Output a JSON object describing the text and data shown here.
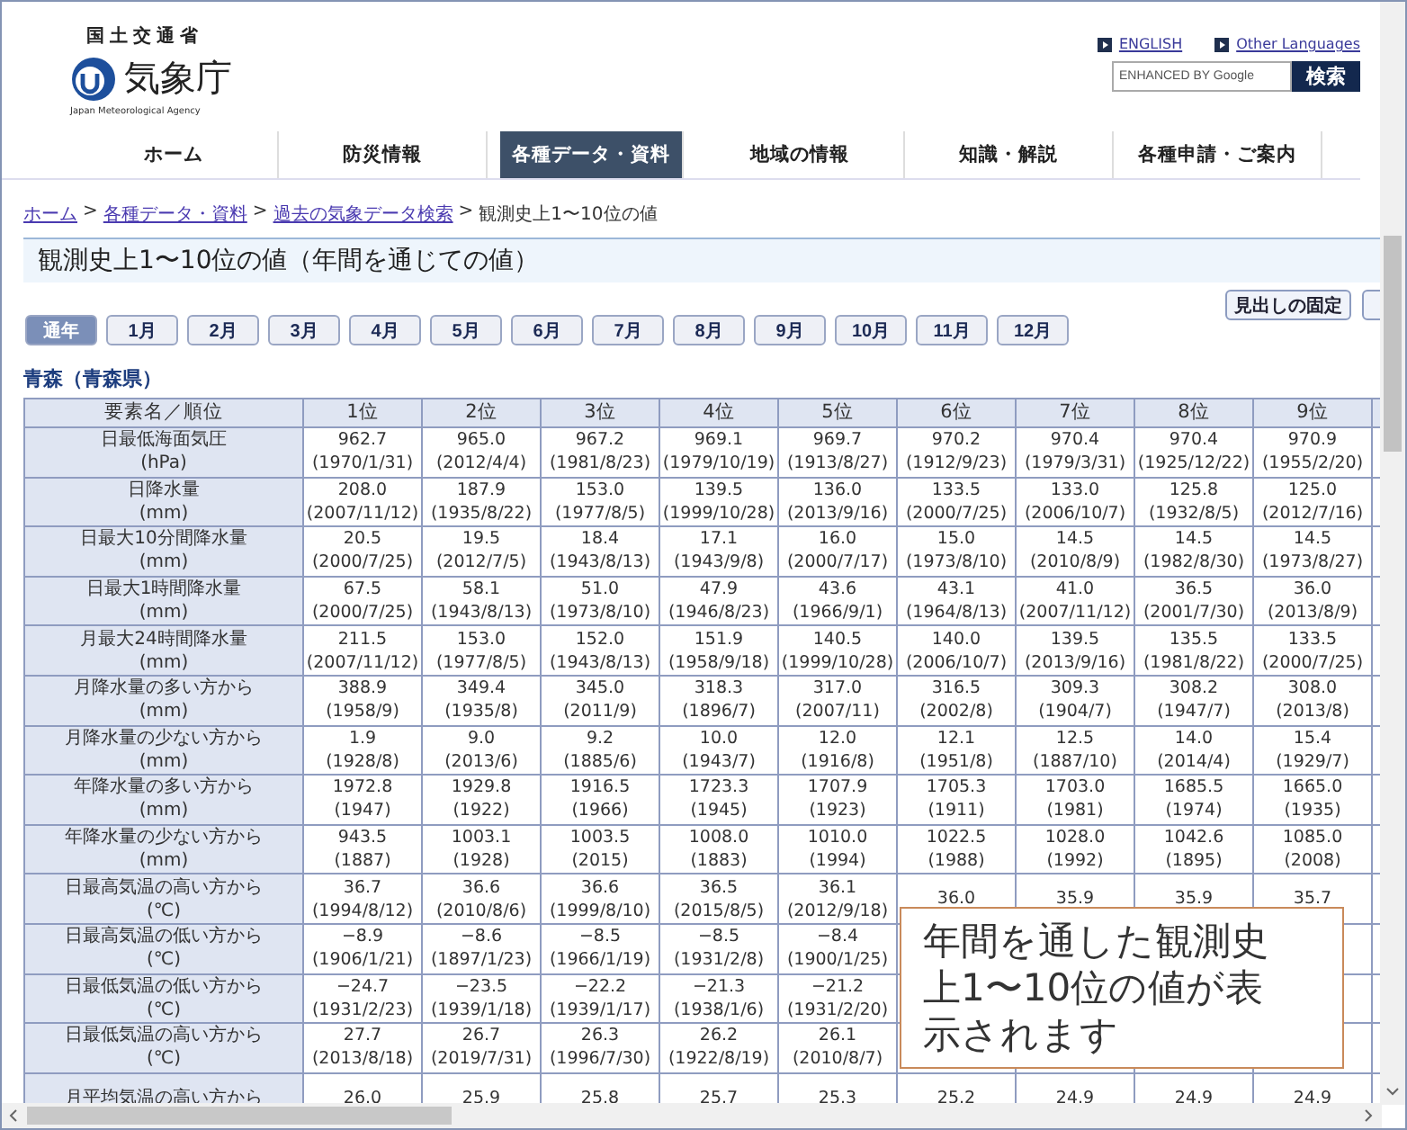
{
  "header": {
    "ministry": "国土交通省",
    "agency": "気象庁",
    "agency_en": "Japan Meteorological Agency",
    "links": [
      "ENGLISH",
      "Other Languages"
    ],
    "search": {
      "placeholder": "ENHANCED BY Google",
      "button": "検索"
    }
  },
  "nav": [
    {
      "label": "ホーム",
      "selected": false
    },
    {
      "label": "防災情報",
      "selected": false
    },
    {
      "label": "各種データ・資料",
      "selected": true
    },
    {
      "label": "地域の情報",
      "selected": false
    },
    {
      "label": "知識・解説",
      "selected": false
    },
    {
      "label": "各種申請・ご案内",
      "selected": false
    }
  ],
  "breadcrumb": {
    "separator": ">",
    "items": [
      {
        "label": "ホーム",
        "link": true
      },
      {
        "label": "各種データ・資料",
        "link": true
      },
      {
        "label": "過去の気象データ検索",
        "link": true
      },
      {
        "label": "観測史上1〜10位の値",
        "link": false
      }
    ]
  },
  "page_title": "観測史上1〜10位の値（年間を通じての値）",
  "fix_header_button": "見出しの固定",
  "month_tabs": [
    {
      "label": "通年",
      "selected": true
    },
    {
      "label": "1月",
      "selected": false
    },
    {
      "label": "2月",
      "selected": false
    },
    {
      "label": "3月",
      "selected": false
    },
    {
      "label": "4月",
      "selected": false
    },
    {
      "label": "5月",
      "selected": false
    },
    {
      "label": "6月",
      "selected": false
    },
    {
      "label": "7月",
      "selected": false
    },
    {
      "label": "8月",
      "selected": false
    },
    {
      "label": "9月",
      "selected": false
    },
    {
      "label": "10月",
      "selected": false
    },
    {
      "label": "11月",
      "selected": false
    },
    {
      "label": "12月",
      "selected": false
    }
  ],
  "station": "青森（青森県）",
  "table": {
    "corner": "要素名／順位",
    "columns": [
      "1位",
      "2位",
      "3位",
      "4位",
      "5位",
      "6位",
      "7位",
      "8位",
      "9位"
    ],
    "rows": [
      {
        "element": "日最低海面気圧",
        "unit": "(hPa)",
        "cells": [
          {
            "value": "962.7",
            "date": "(1970/1/31)"
          },
          {
            "value": "965.0",
            "date": "(2012/4/4)"
          },
          {
            "value": "967.2",
            "date": "(1981/8/23)"
          },
          {
            "value": "969.1",
            "date": "(1979/10/19)"
          },
          {
            "value": "969.7",
            "date": "(1913/8/27)"
          },
          {
            "value": "970.2",
            "date": "(1912/9/23)"
          },
          {
            "value": "970.4",
            "date": "(1979/3/31)"
          },
          {
            "value": "970.4",
            "date": "(1925/12/22)"
          },
          {
            "value": "970.9",
            "date": "(1955/2/20)"
          }
        ]
      },
      {
        "element": "日降水量",
        "unit": "(mm)",
        "cells": [
          {
            "value": "208.0",
            "date": "(2007/11/12)"
          },
          {
            "value": "187.9",
            "date": "(1935/8/22)"
          },
          {
            "value": "153.0",
            "date": "(1977/8/5)"
          },
          {
            "value": "139.5",
            "date": "(1999/10/28)"
          },
          {
            "value": "136.0",
            "date": "(2013/9/16)"
          },
          {
            "value": "133.5",
            "date": "(2000/7/25)"
          },
          {
            "value": "133.0",
            "date": "(2006/10/7)"
          },
          {
            "value": "125.8",
            "date": "(1932/8/5)"
          },
          {
            "value": "125.0",
            "date": "(2012/7/16)"
          }
        ]
      },
      {
        "element": "日最大10分間降水量",
        "unit": "(mm)",
        "cells": [
          {
            "value": "20.5",
            "date": "(2000/7/25)"
          },
          {
            "value": "19.5",
            "date": "(2012/7/5)"
          },
          {
            "value": "18.4",
            "date": "(1943/8/13)"
          },
          {
            "value": "17.1",
            "date": "(1943/9/8)"
          },
          {
            "value": "16.0",
            "date": "(2000/7/17)"
          },
          {
            "value": "15.0",
            "date": "(1973/8/10)"
          },
          {
            "value": "14.5",
            "date": "(2010/8/9)"
          },
          {
            "value": "14.5",
            "date": "(1982/8/30)"
          },
          {
            "value": "14.5",
            "date": "(1973/8/27)"
          }
        ]
      },
      {
        "element": "日最大1時間降水量",
        "unit": "(mm)",
        "cells": [
          {
            "value": "67.5",
            "date": "(2000/7/25)"
          },
          {
            "value": "58.1",
            "date": "(1943/8/13)"
          },
          {
            "value": "51.0",
            "date": "(1973/8/10)"
          },
          {
            "value": "47.9",
            "date": "(1946/8/23)"
          },
          {
            "value": "43.6",
            "date": "(1966/9/1)"
          },
          {
            "value": "43.1",
            "date": "(1964/8/13)"
          },
          {
            "value": "41.0",
            "date": "(2007/11/12)"
          },
          {
            "value": "36.5",
            "date": "(2001/7/30)"
          },
          {
            "value": "36.0",
            "date": "(2013/8/9)"
          }
        ]
      },
      {
        "element": "月最大24時間降水量",
        "unit": "(mm)",
        "cells": [
          {
            "value": "211.5",
            "date": "(2007/11/12)"
          },
          {
            "value": "153.0",
            "date": "(1977/8/5)"
          },
          {
            "value": "152.0",
            "date": "(1943/8/13)"
          },
          {
            "value": "151.9",
            "date": "(1958/9/18)"
          },
          {
            "value": "140.5",
            "date": "(1999/10/28)"
          },
          {
            "value": "140.0",
            "date": "(2006/10/7)"
          },
          {
            "value": "139.5",
            "date": "(2013/9/16)"
          },
          {
            "value": "135.5",
            "date": "(1981/8/22)"
          },
          {
            "value": "133.5",
            "date": "(2000/7/25)"
          }
        ]
      },
      {
        "element": "月降水量の多い方から",
        "unit": "(mm)",
        "cells": [
          {
            "value": "388.9",
            "date": "(1958/9)"
          },
          {
            "value": "349.4",
            "date": "(1935/8)"
          },
          {
            "value": "345.0",
            "date": "(2011/9)"
          },
          {
            "value": "318.3",
            "date": "(1896/7)"
          },
          {
            "value": "317.0",
            "date": "(2007/11)"
          },
          {
            "value": "316.5",
            "date": "(2002/8)"
          },
          {
            "value": "309.3",
            "date": "(1904/7)"
          },
          {
            "value": "308.2",
            "date": "(1947/7)"
          },
          {
            "value": "308.0",
            "date": "(2013/8)"
          }
        ]
      },
      {
        "element": "月降水量の少ない方から",
        "unit": "(mm)",
        "cells": [
          {
            "value": "1.9",
            "date": "(1928/8)"
          },
          {
            "value": "9.0",
            "date": "(2013/6)"
          },
          {
            "value": "9.2",
            "date": "(1885/6)"
          },
          {
            "value": "10.0",
            "date": "(1943/7)"
          },
          {
            "value": "12.0",
            "date": "(1916/8)"
          },
          {
            "value": "12.1",
            "date": "(1951/8)"
          },
          {
            "value": "12.5",
            "date": "(1887/10)"
          },
          {
            "value": "14.0",
            "date": "(2014/4)"
          },
          {
            "value": "15.4",
            "date": "(1929/7)"
          }
        ]
      },
      {
        "element": "年降水量の多い方から",
        "unit": "(mm)",
        "cells": [
          {
            "value": "1972.8",
            "date": "(1947)"
          },
          {
            "value": "1929.8",
            "date": "(1922)"
          },
          {
            "value": "1916.5",
            "date": "(1966)"
          },
          {
            "value": "1723.3",
            "date": "(1945)"
          },
          {
            "value": "1707.9",
            "date": "(1923)"
          },
          {
            "value": "1705.3",
            "date": "(1911)"
          },
          {
            "value": "1703.0",
            "date": "(1981)"
          },
          {
            "value": "1685.5",
            "date": "(1974)"
          },
          {
            "value": "1665.0",
            "date": "(1935)"
          }
        ]
      },
      {
        "element": "年降水量の少ない方から",
        "unit": "(mm)",
        "cells": [
          {
            "value": "943.5",
            "date": "(1887)"
          },
          {
            "value": "1003.1",
            "date": "(1928)"
          },
          {
            "value": "1003.5",
            "date": "(2015)"
          },
          {
            "value": "1008.0",
            "date": "(1883)"
          },
          {
            "value": "1010.0",
            "date": "(1994)"
          },
          {
            "value": "1022.5",
            "date": "(1988)"
          },
          {
            "value": "1028.0",
            "date": "(1992)"
          },
          {
            "value": "1042.6",
            "date": "(1895)"
          },
          {
            "value": "1085.0",
            "date": "(2008)"
          }
        ]
      },
      {
        "element": "日最高気温の高い方から",
        "unit": "(℃)",
        "cells": [
          {
            "value": "36.7",
            "date": "(1994/8/12)"
          },
          {
            "value": "36.6",
            "date": "(2010/8/6)"
          },
          {
            "value": "36.6",
            "date": "(1999/8/10)"
          },
          {
            "value": "36.5",
            "date": "(2015/8/5)"
          },
          {
            "value": "36.1",
            "date": "(2012/9/18)"
          },
          {
            "value": "36.0"
          },
          {
            "value": "35.9"
          },
          {
            "value": "35.9"
          },
          {
            "value": "35.7"
          }
        ]
      },
      {
        "element": "日最高気温の低い方から",
        "unit": "(℃)",
        "cells": [
          {
            "value": "−8.9",
            "date": "(1906/1/21)"
          },
          {
            "value": "−8.6",
            "date": "(1897/1/23)"
          },
          {
            "value": "−8.5",
            "date": "(1966/1/19)"
          },
          {
            "value": "−8.5",
            "date": "(1931/2/8)"
          },
          {
            "value": "−8.4",
            "date": "(1900/1/25)"
          },
          null,
          null,
          null,
          null
        ]
      },
      {
        "element": "日最低気温の低い方から",
        "unit": "(℃)",
        "cells": [
          {
            "value": "−24.7",
            "date": "(1931/2/23)"
          },
          {
            "value": "−23.5",
            "date": "(1939/1/18)"
          },
          {
            "value": "−22.2",
            "date": "(1939/1/17)"
          },
          {
            "value": "−21.3",
            "date": "(1938/1/6)"
          },
          {
            "value": "−21.2",
            "date": "(1931/2/20)"
          },
          null,
          null,
          null,
          null
        ]
      },
      {
        "element": "日最低気温の高い方から",
        "unit": "(℃)",
        "cells": [
          {
            "value": "27.7",
            "date": "(2013/8/18)"
          },
          {
            "value": "26.7",
            "date": "(2019/7/31)"
          },
          {
            "value": "26.3",
            "date": "(1996/7/30)"
          },
          {
            "value": "26.2",
            "date": "(1922/8/19)"
          },
          {
            "value": "26.1",
            "date": "(2010/8/7)"
          },
          null,
          null,
          null,
          null
        ]
      },
      {
        "element": "月平均気温の高い方から",
        "cells": [
          {
            "value": "26.0"
          },
          {
            "value": "25.9"
          },
          {
            "value": "25.8"
          },
          {
            "value": "25.7"
          },
          {
            "value": "25.3"
          },
          {
            "value": "25.2"
          },
          {
            "value": "24.9"
          },
          {
            "value": "24.9"
          },
          {
            "value": "24.9"
          }
        ]
      }
    ]
  },
  "callout": "年間を通した観測史上1〜10位の値が表示されます"
}
